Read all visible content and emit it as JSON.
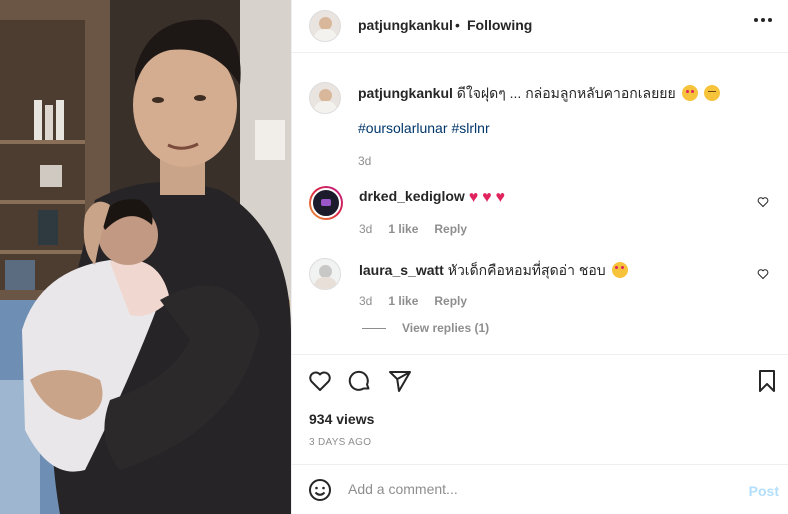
{
  "post": {
    "image_alt": "Man holding sleeping newborn baby wrapped in white blanket"
  },
  "header": {
    "username": "patjungkankul",
    "separator": "•",
    "follow_status": "Following"
  },
  "caption": {
    "username": "patjungkankul",
    "text": "ดีใจฝุดๆ ... กล่อมลูกหลับคาอกเลยยย",
    "hashtags": [
      "#oursolarlunar",
      "#slrlnr"
    ],
    "time": "3d"
  },
  "comments": [
    {
      "username": "drked_kediglow",
      "text": "",
      "time": "3d",
      "likes": "1 like",
      "reply_label": "Reply"
    },
    {
      "username": "laura_s_watt",
      "text": "หัวเด็กคือหอมที่สุดอ่า ชอบ",
      "time": "3d",
      "likes": "1 like",
      "reply_label": "Reply"
    }
  ],
  "view_replies": "View replies (1)",
  "stats": {
    "views": "934 views",
    "posted": "3 DAYS AGO"
  },
  "add_comment": {
    "placeholder": "Add a comment...",
    "post_label": "Post"
  },
  "icons": {
    "more": "more-options-icon",
    "like": "heart-icon",
    "comment": "comment-icon",
    "share": "paper-plane-icon",
    "save": "bookmark-icon",
    "emoji": "smiley-icon"
  },
  "colors": {
    "link": "#00376b",
    "muted": "#8e8e8e",
    "post_disabled": "#b2dffc",
    "heart": "#e0245e"
  }
}
